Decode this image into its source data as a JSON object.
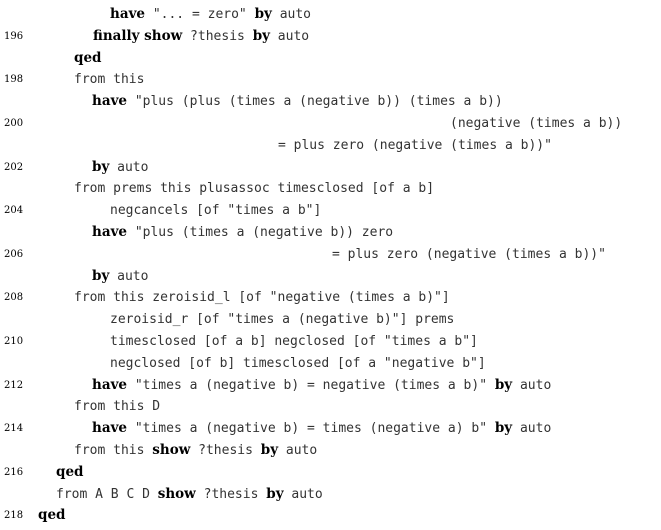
{
  "lines": [
    {
      "num": "",
      "indent": 110,
      "segs": [
        {
          "t": "have",
          "kw": true
        },
        {
          "t": " \"... = zero\" "
        },
        {
          "t": "by",
          "kw": true
        },
        {
          "t": " auto"
        }
      ]
    },
    {
      "num": "196",
      "indent": 93,
      "segs": [
        {
          "t": "finally show",
          "kw": true
        },
        {
          "t": " ?thesis "
        },
        {
          "t": "by",
          "kw": true
        },
        {
          "t": " auto"
        }
      ]
    },
    {
      "num": "",
      "indent": 74,
      "segs": [
        {
          "t": "qed",
          "kw": true
        }
      ]
    },
    {
      "num": "198",
      "indent": 74,
      "segs": [
        {
          "t": "from this"
        }
      ]
    },
    {
      "num": "",
      "indent": 92,
      "segs": [
        {
          "t": "have",
          "kw": true
        },
        {
          "t": " \"plus (plus (times a (negative b)) (times a b))"
        }
      ]
    },
    {
      "num": "200",
      "indent": 450,
      "segs": [
        {
          "t": "(negative (times a b))"
        }
      ]
    },
    {
      "num": "",
      "indent": 278,
      "segs": [
        {
          "t": "= plus zero (negative (times a b))\""
        }
      ]
    },
    {
      "num": "202",
      "indent": 92,
      "segs": [
        {
          "t": "by",
          "kw": true
        },
        {
          "t": " auto"
        }
      ]
    },
    {
      "num": "",
      "indent": 74,
      "segs": [
        {
          "t": "from prems this plusassoc timesclosed [of a b]"
        }
      ]
    },
    {
      "num": "204",
      "indent": 110,
      "segs": [
        {
          "t": "negcancels [of \"times a b\"]"
        }
      ]
    },
    {
      "num": "",
      "indent": 92,
      "segs": [
        {
          "t": "have",
          "kw": true
        },
        {
          "t": " \"plus (times a (negative b)) zero"
        }
      ]
    },
    {
      "num": "206",
      "indent": 332,
      "segs": [
        {
          "t": "= plus zero (negative (times a b))\""
        }
      ]
    },
    {
      "num": "",
      "indent": 92,
      "segs": [
        {
          "t": "by",
          "kw": true
        },
        {
          "t": " auto"
        }
      ]
    },
    {
      "num": "208",
      "indent": 74,
      "segs": [
        {
          "t": "from this zeroisid_l [of \"negative (times a b)\"]"
        }
      ]
    },
    {
      "num": "",
      "indent": 110,
      "segs": [
        {
          "t": "zeroisid_r [of \"times a (negative b)\"] prems"
        }
      ]
    },
    {
      "num": "210",
      "indent": 110,
      "segs": [
        {
          "t": "timesclosed [of a b] negclosed [of \"times a b\"]"
        }
      ]
    },
    {
      "num": "",
      "indent": 110,
      "segs": [
        {
          "t": "negclosed [of b] timesclosed [of a \"negative b\"]"
        }
      ]
    },
    {
      "num": "212",
      "indent": 92,
      "segs": [
        {
          "t": "have",
          "kw": true
        },
        {
          "t": " \"times a (negative b) = negative (times a b)\" "
        },
        {
          "t": "by",
          "kw": true
        },
        {
          "t": " auto"
        }
      ]
    },
    {
      "num": "",
      "indent": 74,
      "segs": [
        {
          "t": "from this D"
        }
      ]
    },
    {
      "num": "214",
      "indent": 92,
      "segs": [
        {
          "t": "have",
          "kw": true
        },
        {
          "t": " \"times a (negative b) = times (negative a) b\" "
        },
        {
          "t": "by",
          "kw": true
        },
        {
          "t": " auto"
        }
      ]
    },
    {
      "num": "",
      "indent": 74,
      "segs": [
        {
          "t": "from this "
        },
        {
          "t": "show",
          "kw": true
        },
        {
          "t": " ?thesis "
        },
        {
          "t": "by",
          "kw": true
        },
        {
          "t": " auto"
        }
      ]
    },
    {
      "num": "216",
      "indent": 56,
      "segs": [
        {
          "t": "qed",
          "kw": true
        }
      ]
    },
    {
      "num": "",
      "indent": 56,
      "segs": [
        {
          "t": "from A B C D "
        },
        {
          "t": "show",
          "kw": true
        },
        {
          "t": " ?thesis "
        },
        {
          "t": "by",
          "kw": true
        },
        {
          "t": " auto"
        }
      ]
    },
    {
      "num": "218",
      "indent": 38,
      "segs": [
        {
          "t": "qed",
          "kw": true
        }
      ]
    }
  ]
}
